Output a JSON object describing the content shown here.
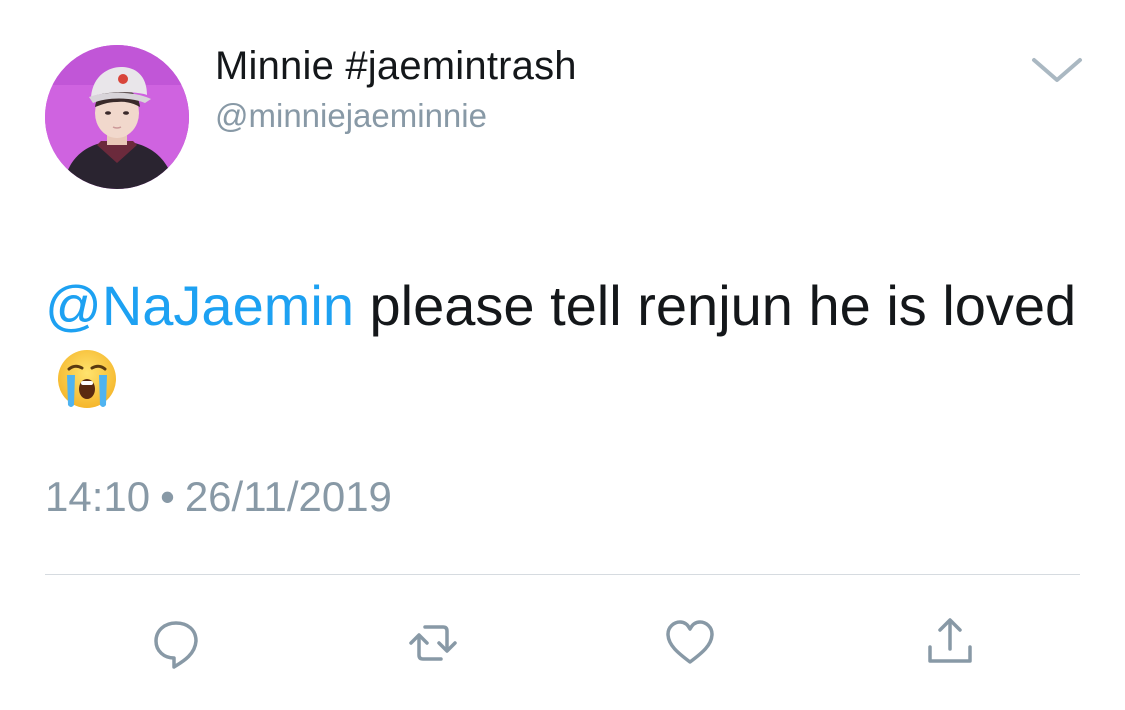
{
  "author": {
    "display_name": "Minnie #jaemintrash",
    "handle": "@minniejaeminnie"
  },
  "menu": {
    "icon": "chevron-down-icon"
  },
  "tweet": {
    "mention": "@NaJaemin",
    "text": " please tell renjun he is loved",
    "emoji": "loudly-crying-face-emoji"
  },
  "meta": {
    "time": "14:10",
    "separator": "•",
    "date": "26/11/2019"
  },
  "actions": [
    {
      "name": "reply",
      "icon": "reply-icon"
    },
    {
      "name": "retweet",
      "icon": "retweet-icon"
    },
    {
      "name": "like",
      "icon": "heart-icon"
    },
    {
      "name": "share",
      "icon": "share-icon"
    }
  ],
  "colors": {
    "text": "#14171a",
    "secondary": "#8899a6",
    "link": "#1da1f2",
    "divider": "#d6dbe0"
  }
}
